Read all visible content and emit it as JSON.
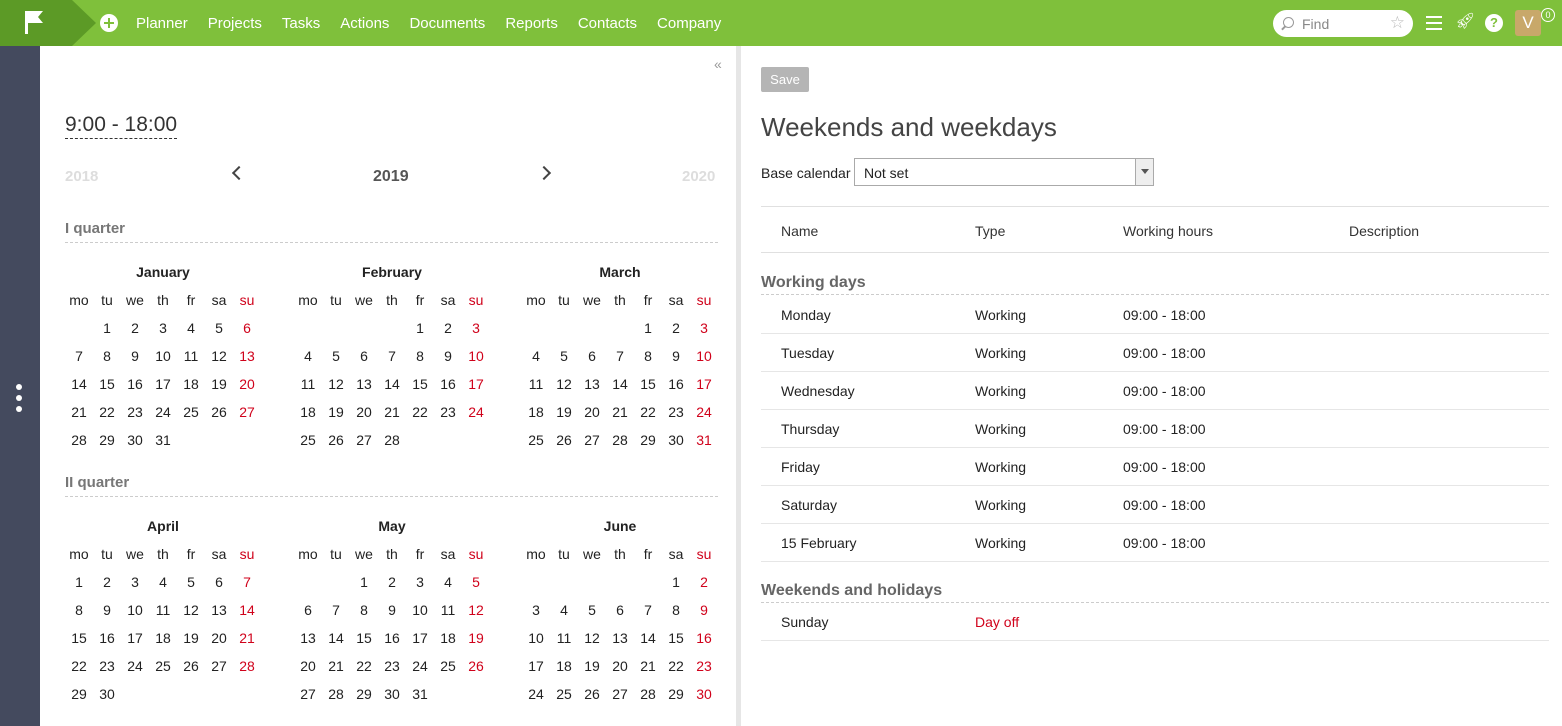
{
  "nav": [
    "Planner",
    "Projects",
    "Tasks",
    "Actions",
    "Documents",
    "Reports",
    "Contacts",
    "Company"
  ],
  "search": {
    "placeholder": "Find"
  },
  "user": {
    "avatar_letter": "V",
    "notifications": "0"
  },
  "calendar": {
    "hours": "9:00 - 18:00",
    "prev_year": "2018",
    "current_year": "2019",
    "next_year": "2020",
    "weekdays": [
      "mo",
      "tu",
      "we",
      "th",
      "fr",
      "sa",
      "su"
    ],
    "quarters": [
      {
        "title": "I quarter",
        "months": [
          {
            "name": "January",
            "offset": 1,
            "days": 31
          },
          {
            "name": "February",
            "offset": 4,
            "days": 28
          },
          {
            "name": "March",
            "offset": 4,
            "days": 31
          }
        ]
      },
      {
        "title": "II quarter",
        "months": [
          {
            "name": "April",
            "offset": 0,
            "days": 30
          },
          {
            "name": "May",
            "offset": 2,
            "days": 31
          },
          {
            "name": "June",
            "offset": 5,
            "days": 30
          }
        ]
      }
    ]
  },
  "right": {
    "save_label": "Save",
    "title": "Weekends and weekdays",
    "base_calendar_label": "Base calendar",
    "base_calendar_value": "Not set",
    "columns": {
      "name": "Name",
      "type": "Type",
      "hours": "Working hours",
      "description": "Description"
    },
    "working_title": "Working days",
    "working_days": [
      {
        "name": "Monday",
        "type": "Working",
        "hours": "09:00 - 18:00"
      },
      {
        "name": "Tuesday",
        "type": "Working",
        "hours": "09:00 - 18:00"
      },
      {
        "name": "Wednesday",
        "type": "Working",
        "hours": "09:00 - 18:00"
      },
      {
        "name": "Thursday",
        "type": "Working",
        "hours": "09:00 - 18:00"
      },
      {
        "name": "Friday",
        "type": "Working",
        "hours": "09:00 - 18:00"
      },
      {
        "name": "Saturday",
        "type": "Working",
        "hours": "09:00 - 18:00"
      },
      {
        "name": "15 February",
        "type": "Working",
        "hours": "09:00 - 18:00"
      }
    ],
    "holidays_title": "Weekends and holidays",
    "holidays": [
      {
        "name": "Sunday",
        "type": "Day off",
        "hours": ""
      }
    ]
  },
  "colors": {
    "brand_green": "#7fc03b",
    "rail": "#444a5e",
    "weekend_red": "#d0021b"
  }
}
